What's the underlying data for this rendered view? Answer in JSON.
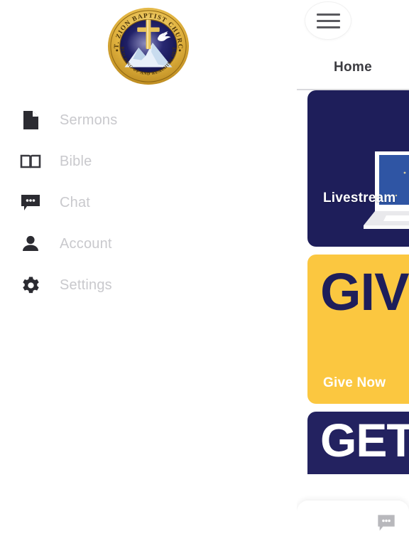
{
  "app": {
    "brand": {
      "logo_icon": "church-seal-logo",
      "ring_text_top": "MT. ZION BAPTIST CHURCH",
      "ring_text_bottom": "BUILDING UP AND REACHING OUT",
      "colors": {
        "gold": "#d8a72a",
        "navy": "#1b1b5e"
      }
    }
  },
  "drawer": {
    "items": [
      {
        "label": "Sermons",
        "icon": "document-icon"
      },
      {
        "label": "Bible",
        "icon": "open-book-icon"
      },
      {
        "label": "Chat",
        "icon": "chat-bubble-icon"
      },
      {
        "label": "Account",
        "icon": "person-icon"
      },
      {
        "label": "Settings",
        "icon": "gear-icon"
      }
    ]
  },
  "main": {
    "menu_button_icon": "hamburger-menu-icon",
    "title": "Home",
    "cards": [
      {
        "caption": "Livestream",
        "art": "laptop-icon",
        "bg": "#1e1e5a"
      },
      {
        "word": "GIVE",
        "caption": "Give Now",
        "bg": "#fbc740"
      },
      {
        "word": "GET",
        "bg": "#232260"
      }
    ],
    "bottom_bar": {
      "chat_icon": "chat-bubble-icon"
    }
  }
}
